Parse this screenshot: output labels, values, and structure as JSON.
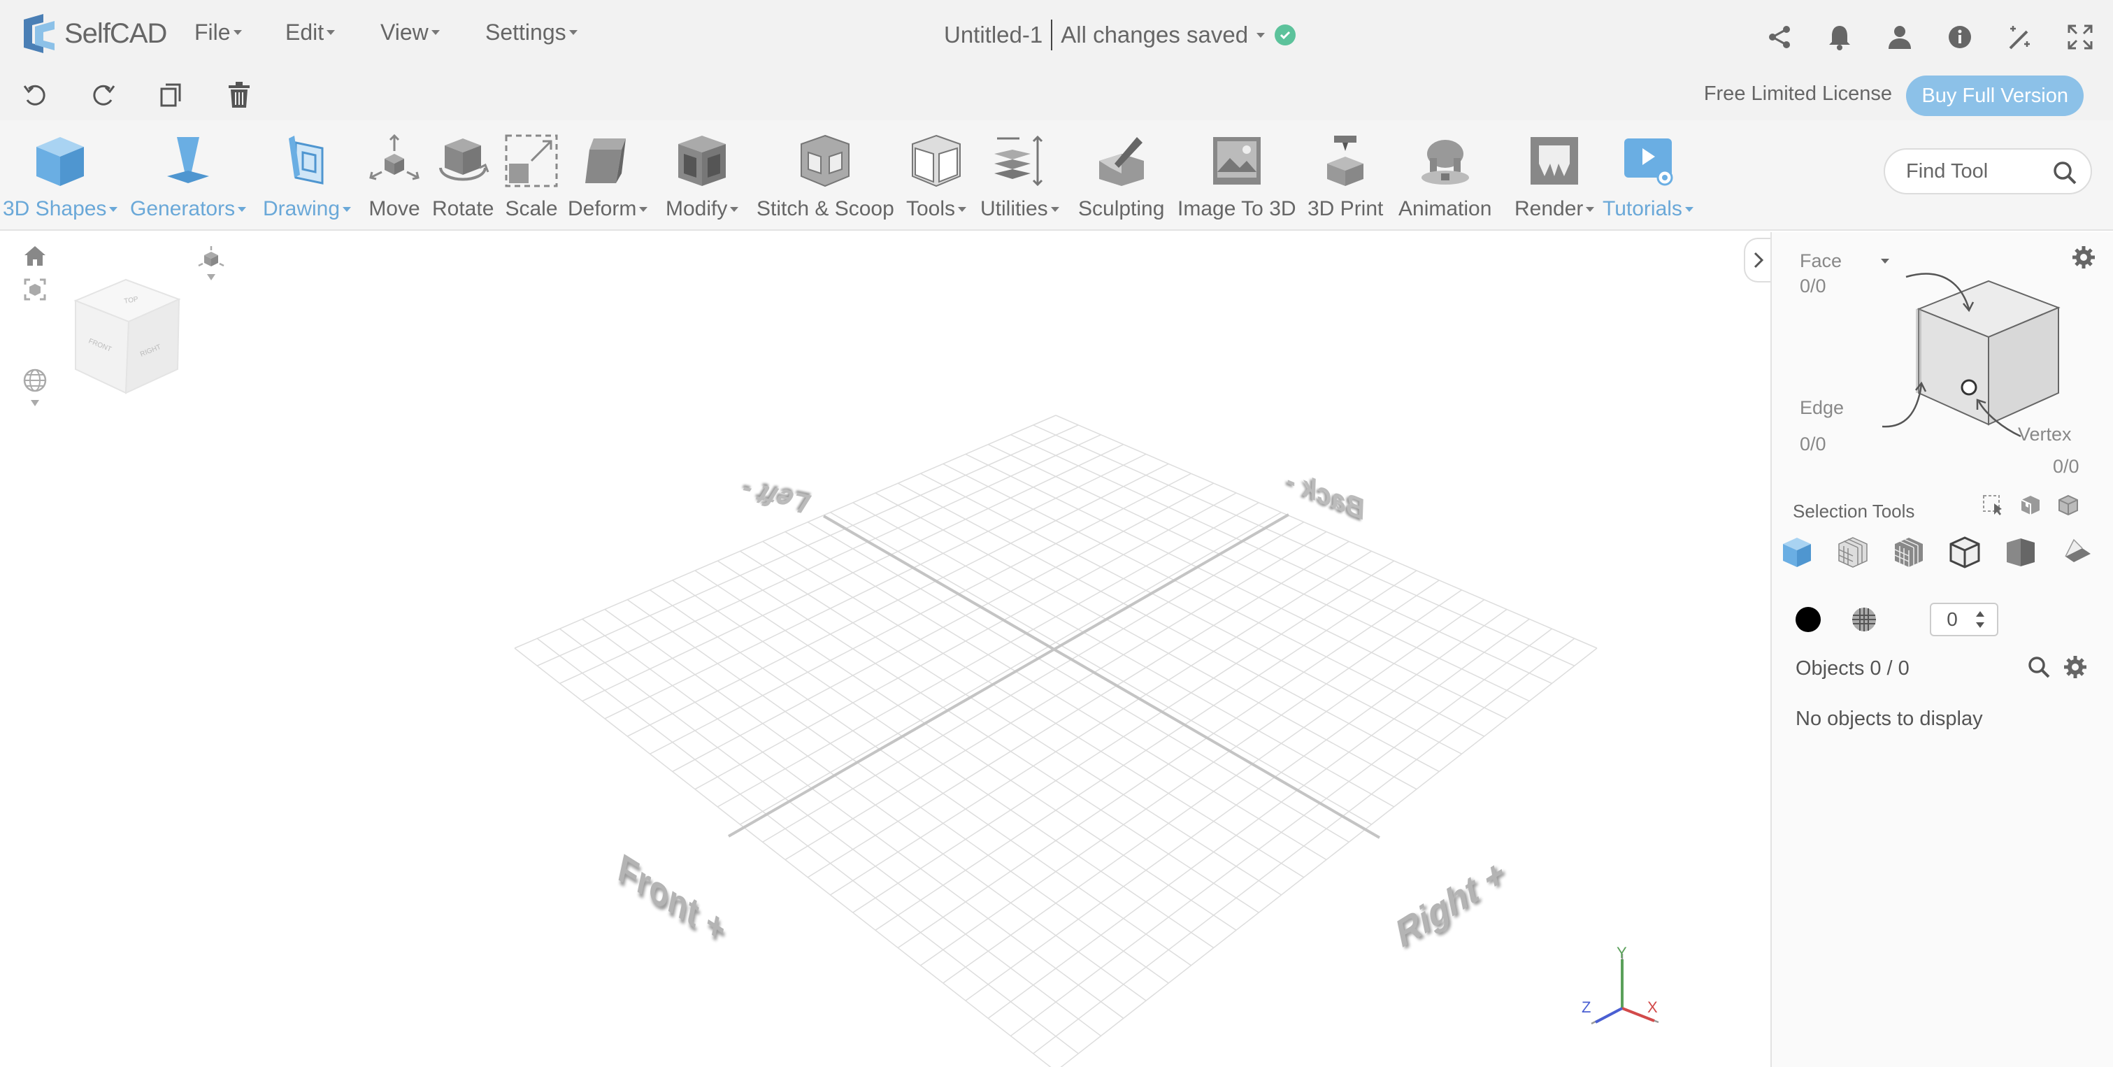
{
  "app": {
    "name": "SelfCAD"
  },
  "menu": [
    "File",
    "Edit",
    "View",
    "Settings"
  ],
  "document": {
    "title": "Untitled-1",
    "save_status": "All changes saved"
  },
  "top_icons": [
    "share-icon",
    "bell-icon",
    "user-icon",
    "info-icon",
    "magic-wand-icon",
    "fullscreen-icon"
  ],
  "edit_bar": {
    "icons": [
      "undo-icon",
      "redo-icon",
      "duplicate-icon",
      "trash-icon"
    ],
    "license": "Free Limited License",
    "buy_button": "Buy Full Version"
  },
  "toolbar": {
    "tools": [
      {
        "label": "3D Shapes",
        "dropdown": true,
        "highlight": true,
        "icon": "cube-icon"
      },
      {
        "label": "Generators",
        "dropdown": true,
        "highlight": true,
        "icon": "generator-icon"
      },
      {
        "label": "Drawing",
        "dropdown": true,
        "highlight": true,
        "icon": "drawing-icon"
      },
      {
        "label": "Move",
        "dropdown": false,
        "highlight": false,
        "icon": "move-icon"
      },
      {
        "label": "Rotate",
        "dropdown": false,
        "highlight": false,
        "icon": "rotate-icon"
      },
      {
        "label": "Scale",
        "dropdown": false,
        "highlight": false,
        "icon": "scale-icon"
      },
      {
        "label": "Deform",
        "dropdown": true,
        "highlight": false,
        "icon": "deform-icon"
      },
      {
        "label": "Modify",
        "dropdown": true,
        "highlight": false,
        "icon": "modify-icon"
      },
      {
        "label": "Stitch & Scoop",
        "dropdown": false,
        "highlight": false,
        "icon": "stitch-scoop-icon"
      },
      {
        "label": "Tools",
        "dropdown": true,
        "highlight": false,
        "icon": "tools-icon"
      },
      {
        "label": "Utilities",
        "dropdown": true,
        "highlight": false,
        "icon": "utilities-icon"
      },
      {
        "label": "Sculpting",
        "dropdown": false,
        "highlight": false,
        "icon": "sculpting-icon"
      },
      {
        "label": "Image To 3D",
        "dropdown": false,
        "highlight": false,
        "icon": "image-to-3d-icon"
      },
      {
        "label": "3D Print",
        "dropdown": false,
        "highlight": false,
        "icon": "3d-print-icon"
      },
      {
        "label": "Animation",
        "dropdown": false,
        "highlight": false,
        "icon": "animation-icon"
      },
      {
        "label": "Render",
        "dropdown": true,
        "highlight": false,
        "icon": "render-icon"
      },
      {
        "label": "Tutorials",
        "dropdown": true,
        "highlight": true,
        "icon": "tutorials-icon"
      }
    ],
    "find_tool_placeholder": "Find Tool"
  },
  "viewport": {
    "grid_labels": [
      "Left -",
      "Back -",
      "Front +",
      "Right +"
    ],
    "view_cube_faces": [
      "TOP",
      "FRONT",
      "RIGHT"
    ],
    "axes": [
      "Y",
      "Z",
      "X"
    ]
  },
  "panel": {
    "face_label": "Face",
    "face_count": "0/0",
    "edge_label": "Edge",
    "edge_count": "0/0",
    "vertex_label": "Vertex",
    "vertex_count": "0/0",
    "selection_tools": "Selection Tools",
    "stepper_value": "0",
    "objects": "Objects 0 / 0",
    "empty": "No objects to display"
  },
  "colors": {
    "accent": "#8cc1e8",
    "toolbar_blue": "#6aa8d8",
    "saved": "#5cc29b"
  }
}
